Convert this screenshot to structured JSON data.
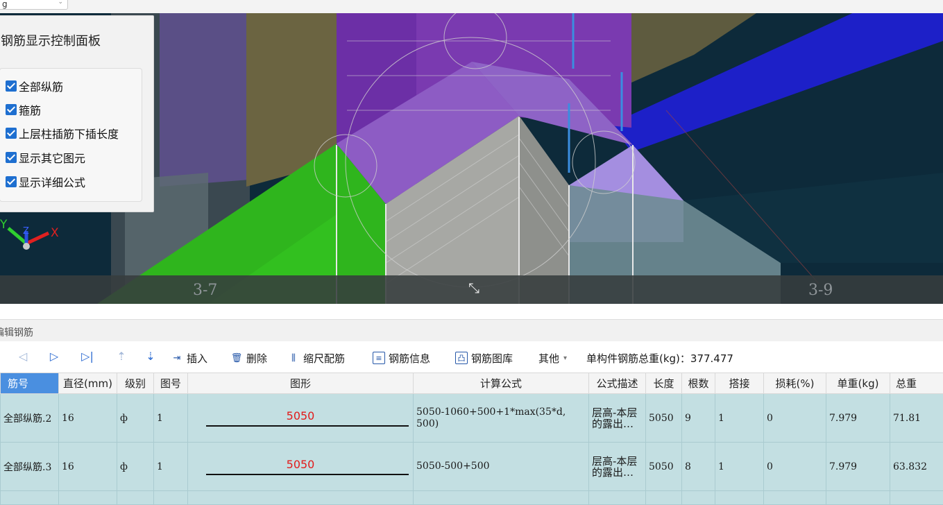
{
  "top": {
    "combo_value": "g"
  },
  "viewport": {
    "panel": {
      "title": "钢筋显示控制面板",
      "options": [
        {
          "label": "全部纵筋",
          "checked": true
        },
        {
          "label": "箍筋",
          "checked": true
        },
        {
          "label": "上层柱插筋下插长度",
          "checked": true
        },
        {
          "label": "显示其它图元",
          "checked": true
        },
        {
          "label": "显示详细公式",
          "checked": true
        }
      ]
    },
    "axis": {
      "y": "Y",
      "z": "Z",
      "x": "X"
    },
    "grid_labels": {
      "left": "3-7",
      "right": "3-9"
    },
    "colors": {
      "green": "#2fb51d",
      "purple": "#7a3ab0",
      "lavender": "#a48ee0",
      "olive": "#5e5b3f",
      "blue": "#1d20c8",
      "teal_bg": "#0d2a3a"
    }
  },
  "section": {
    "title": "编辑钢筋"
  },
  "toolbar": {
    "insert": "插入",
    "delete": "删除",
    "scale": "缩尺配筋",
    "info": "钢筋信息",
    "library": "钢筋图库",
    "other": "其他",
    "weight_label": "单构件钢筋总重(kg)：377.477"
  },
  "table": {
    "headers": [
      "筋号",
      "直径(mm)",
      "级别",
      "图号",
      "图形",
      "计算公式",
      "公式描述",
      "长度",
      "根数",
      "搭接",
      "损耗(%)",
      "单重(kg)",
      "总重"
    ],
    "rows": [
      {
        "name": "全部纵筋.2",
        "dia": "16",
        "grade": "ф",
        "fig": "1",
        "shape": "5050",
        "formula": "5050-1060+500+1*max(35*d, 500)",
        "desc": "层高-本层的露出…",
        "len": "5050",
        "count": "9",
        "lap": "1",
        "loss": "0",
        "unit_w": "7.979",
        "total_w": "71.81"
      },
      {
        "name": "全部纵筋.3",
        "dia": "16",
        "grade": "ф",
        "fig": "1",
        "shape": "5050",
        "formula": "5050-500+500",
        "desc": "层高-本层的露出…",
        "len": "5050",
        "count": "8",
        "lap": "1",
        "loss": "0",
        "unit_w": "7.979",
        "total_w": "63.832"
      }
    ]
  }
}
